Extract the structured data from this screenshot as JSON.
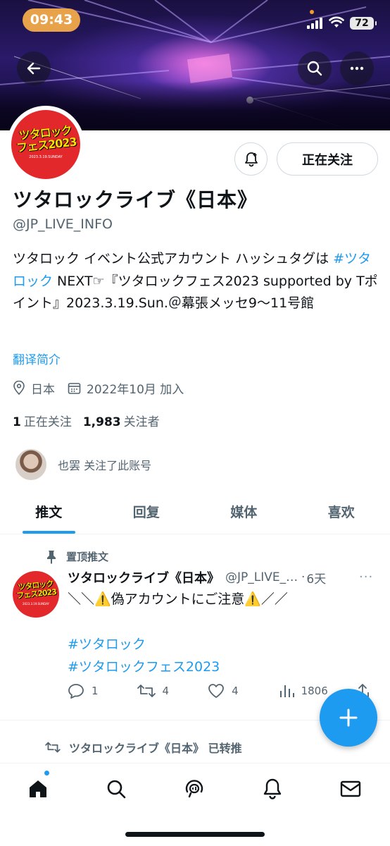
{
  "status_bar": {
    "time": "09:43",
    "battery": "72"
  },
  "banner": {
    "back_icon": "arrow-left-icon",
    "search_icon": "search-icon",
    "more_icon": "more-horizontal-icon"
  },
  "profile": {
    "avatar_logo_line1": "ツタロック",
    "avatar_logo_line2": "フェス2023",
    "avatar_logo_sub": "2023.3.19.SUNDAY",
    "follow_button": "正在关注",
    "display_name": "ツタロックライブ《日本》",
    "handle": "@JP_LIVE_INFO",
    "bio_part1": "ツタロック イベント公式アカウント ハッシュタグは ",
    "bio_tag": "#ツタロック",
    "bio_part2": " NEXT☞『ツタロックフェス2023 supported by Tポイント』2023.3.19.Sun.＠幕張メッセ9～11号館",
    "translate": "翻译简介",
    "location": "日本",
    "joined": "2022年10月 加入",
    "following_count": "1",
    "following_label": "正在关注",
    "followers_count": "1,983",
    "followers_label": "关注者",
    "followed_by": "也罢 关注了此账号"
  },
  "tabs": [
    {
      "label": "推文",
      "active": true
    },
    {
      "label": "回复",
      "active": false
    },
    {
      "label": "媒体",
      "active": false
    },
    {
      "label": "喜欢",
      "active": false
    }
  ],
  "pinned_tweet": {
    "pin_label": "置顶推文",
    "name": "ツタロックライブ《日本》",
    "handle": "@JP_LIVE_INFO",
    "dot": "·",
    "time": "6天",
    "more": "···",
    "line1": "＼＼⚠️偽アカウントにご注意⚠️／／",
    "tag1": "#ツタロック",
    "tag2": "#ツタロックフェス2023",
    "replies": "1",
    "retweets": "4",
    "likes": "4",
    "views": "1806"
  },
  "retweet_notice": "ツタロックライブ《日本》 已转推",
  "bottom_nav": [
    "home-icon",
    "search-icon",
    "spaces-icon",
    "notifications-icon",
    "messages-icon"
  ],
  "colors": {
    "accent": "#1d9bf0",
    "text": "#0f1419",
    "secondary": "#536471",
    "avatar_red": "#e3282c"
  }
}
